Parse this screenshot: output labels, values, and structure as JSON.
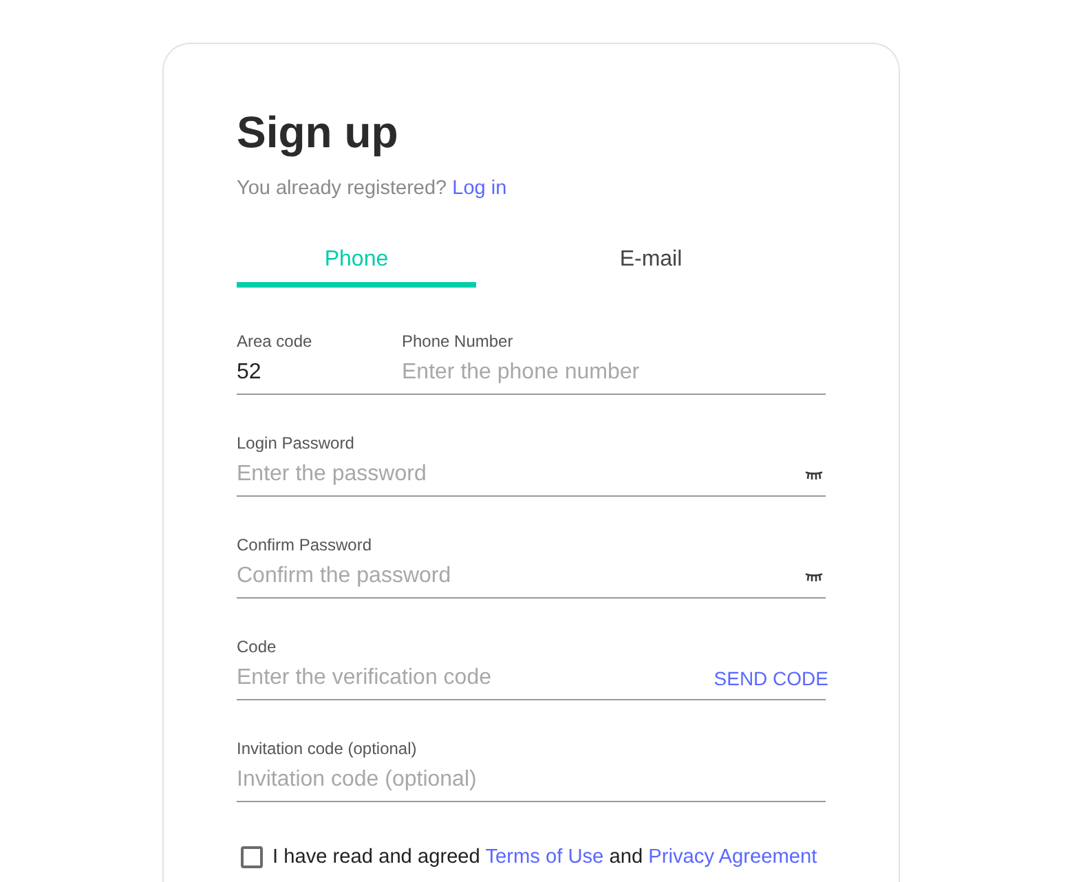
{
  "title": "Sign up",
  "login_prompt": {
    "text": "You already registered?",
    "link": "Log in"
  },
  "tabs": [
    {
      "label": "Phone",
      "selected": true
    },
    {
      "label": "E-mail",
      "selected": false
    }
  ],
  "phone_row": {
    "area_code": {
      "label": "Area code",
      "value": "52"
    },
    "phone_number": {
      "label": "Phone Number",
      "placeholder": "Enter the phone number"
    }
  },
  "fields": [
    {
      "kind": "password",
      "label": "Login Password",
      "placeholder": "Enter the password",
      "visible": false
    },
    {
      "kind": "password",
      "label": "Confirm Password",
      "placeholder": "Confirm the password",
      "visible": false
    },
    {
      "kind": "code",
      "label": "Code",
      "placeholder": "Enter the verification code",
      "action": "SEND CODE"
    },
    {
      "kind": "text",
      "label": "Invitation code (optional)",
      "placeholder": "Invitation code (optional)"
    }
  ],
  "agreement": {
    "checked": false,
    "text": "I have read and agreed",
    "terms_link": "Terms of Use",
    "joiner": "and",
    "privacy_link": "Privacy Agreement"
  }
}
